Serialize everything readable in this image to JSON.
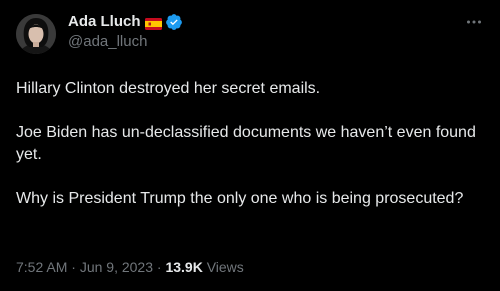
{
  "author": {
    "display_name": "Ada Lluch",
    "flag": "🇪🇸",
    "handle": "@ada_lluch",
    "verified_color": "#1d9bf0"
  },
  "tweet": {
    "paragraphs": [
      "Hillary Clinton destroyed her secret emails.",
      "Joe Biden has un-declassified documents we haven’t even found yet.",
      "Why is President Trump the only one who is being prosecuted?"
    ]
  },
  "meta": {
    "time": "7:52 AM",
    "separator": " · ",
    "date": "Jun 9, 2023",
    "views_count": "13.9K",
    "views_label": " Views"
  },
  "icons": {
    "more": "more-horizontal-icon",
    "verified": "verified-badge-icon",
    "flag": "spain-flag-icon"
  },
  "colors": {
    "background": "#000000",
    "text": "#e7e9ea",
    "secondary": "#71767b",
    "accent": "#1d9bf0"
  }
}
